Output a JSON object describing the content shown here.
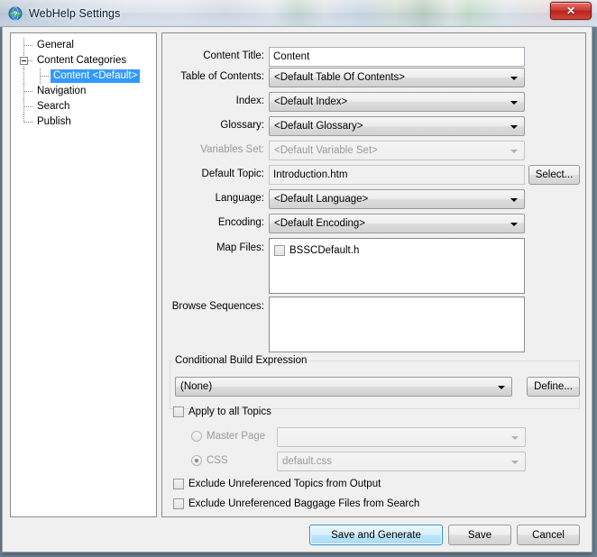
{
  "window": {
    "title": "WebHelp Settings",
    "icon": "globe-help-icon",
    "close_label": "✕"
  },
  "tree": {
    "items": [
      {
        "label": "General",
        "level": 1,
        "selected": false,
        "expandable": false
      },
      {
        "label": "Content Categories",
        "level": 1,
        "selected": false,
        "expandable": true
      },
      {
        "label": "Content <Default>",
        "level": 2,
        "selected": true,
        "expandable": false
      },
      {
        "label": "Navigation",
        "level": 1,
        "selected": false,
        "expandable": false
      },
      {
        "label": "Search",
        "level": 1,
        "selected": false,
        "expandable": false
      },
      {
        "label": "Publish",
        "level": 1,
        "selected": false,
        "expandable": false
      }
    ]
  },
  "form": {
    "content_title": {
      "label": "Content Title:",
      "value": "Content"
    },
    "table_of_contents": {
      "label": "Table of Contents:",
      "value": "<Default Table Of Contents>"
    },
    "index": {
      "label": "Index:",
      "value": "<Default Index>"
    },
    "glossary": {
      "label": "Glossary:",
      "value": "<Default Glossary>"
    },
    "variables_set": {
      "label": "Variables Set:",
      "value": "<Default Variable Set>",
      "disabled": true
    },
    "default_topic": {
      "label": "Default Topic:",
      "value": "Introduction.htm",
      "button": "Select..."
    },
    "language": {
      "label": "Language:",
      "value": "<Default Language>"
    },
    "encoding": {
      "label": "Encoding:",
      "value": "<Default Encoding>"
    },
    "map_files": {
      "label": "Map Files:",
      "items": [
        {
          "label": "BSSCDefault.h",
          "checked": false
        }
      ]
    },
    "browse_sequences": {
      "label": "Browse Sequences:",
      "items": []
    }
  },
  "conditional_build": {
    "title": "Conditional Build Expression",
    "value": "(None)",
    "define_button": "Define..."
  },
  "options": {
    "apply_to_all_topics": {
      "label": "Apply to all Topics",
      "checked": false
    },
    "master_page": {
      "label": "Master Page",
      "selected": false,
      "value": "",
      "disabled": true
    },
    "css": {
      "label": "CSS",
      "selected": true,
      "value": "default.css",
      "disabled": true
    },
    "exclude_topics": {
      "label": "Exclude Unreferenced Topics from Output",
      "checked": false
    },
    "exclude_baggage": {
      "label": "Exclude Unreferenced Baggage Files from Search",
      "checked": false
    }
  },
  "buttons": {
    "save_and_generate": "Save and Generate",
    "save": "Save",
    "cancel": "Cancel"
  },
  "colors": {
    "selection": "#3399ff",
    "default_button": "#bee6fd",
    "close_button": "#cf3a30"
  }
}
